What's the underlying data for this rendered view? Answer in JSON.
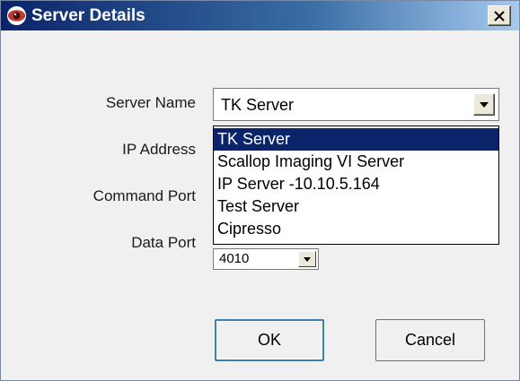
{
  "window": {
    "title": "Server Details",
    "icon": "eye-icon",
    "close_label": "×"
  },
  "form": {
    "server_name_label": "Server Name",
    "ip_address_label": "IP Address",
    "command_port_label": "Command Port",
    "data_port_label": "Data Port",
    "server_name_value": "TK Server",
    "data_port_value": "4010"
  },
  "dropdown": {
    "items": [
      {
        "label": "TK Server",
        "selected": true
      },
      {
        "label": "Scallop Imaging VI Server",
        "selected": false
      },
      {
        "label": "IP Server -10.10.5.164",
        "selected": false
      },
      {
        "label": "Test Server",
        "selected": false
      },
      {
        "label": "Cipresso",
        "selected": false
      }
    ]
  },
  "buttons": {
    "ok_label": "OK",
    "cancel_label": "Cancel"
  },
  "colors": {
    "titlebar_start": "#0a246a",
    "selection": "#0a246a",
    "icon_red": "#c0392b"
  }
}
